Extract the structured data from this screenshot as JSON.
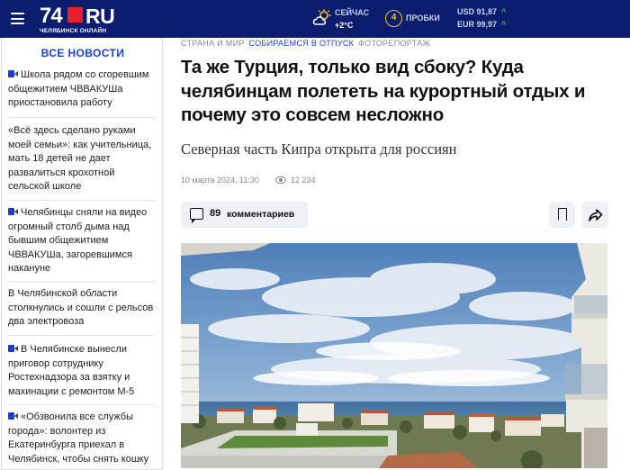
{
  "header": {
    "logo_number": "74",
    "logo_domain": "RU",
    "logo_subtitle": "ЧЕЛЯБИНСК ОНЛАЙН",
    "weather_label": "СЕЙЧАС",
    "weather_temp": "+2°C",
    "traffic_level": "4",
    "traffic_label": "ПРОБКИ",
    "usd": "USD 91,87",
    "eur": "EUR 99,97",
    "colors": {
      "bg": "#0c1c6e",
      "logo_square": "#e8202a",
      "traffic": "#f4c21b",
      "rate_up": "#39c06d"
    }
  },
  "sidebar": {
    "title": "ВСЕ НОВОСТИ",
    "items": [
      {
        "text": "Школа рядом со сгоревшим общежитием ЧВВАКУШа приостановила работу",
        "video": true
      },
      {
        "text": "«Всё здесь сделано руками моей семьи»: как учительница, мать 18 детей не дает развалиться крохотной сельской школе",
        "video": false
      },
      {
        "text": "Челябинцы сняли на видео огромный столб дыма над бывшим общежитием ЧВВАКУШа, загоревшимся накануне",
        "video": true
      },
      {
        "text": "В Челябинской области столкнулись и сошли с рельсов два электровоза",
        "video": false
      },
      {
        "text": "В Челябинске вынесли приговор сотруднику Ростехнадзора за взятку и махинации с ремонтом М-5",
        "video": true
      },
      {
        "text": "«Обзвонила все службы города»: волонтер из Екатеринбурга приехал в Челябинск, чтобы снять кошку",
        "video": true
      }
    ]
  },
  "article": {
    "rubric": "СТРАНА И МИР",
    "tag": "СОБИРАЕМСЯ В ОТПУСК",
    "format": "ФОТОРЕПОРТАЖ",
    "title": "Та же Турция, только вид сбоку? Куда челябинцам полететь на курортный отдых и почему это совсем несложно",
    "subtitle": "Северная часть Кипра открыта для россиян",
    "date": "10 марта 2024, 11:30",
    "views": "12 234",
    "comments_count": "89",
    "comments_label": "комментариев"
  }
}
